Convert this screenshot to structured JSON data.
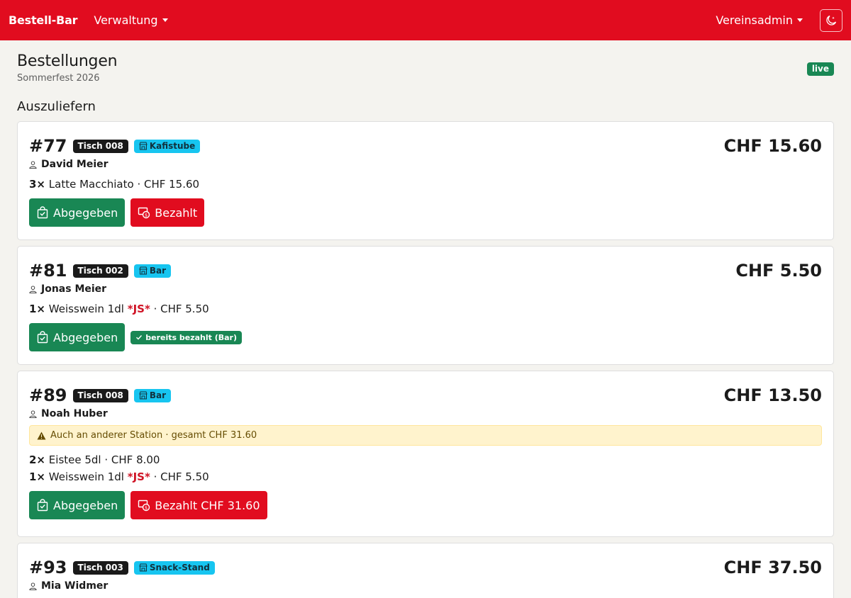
{
  "navbar": {
    "brand": "Bestell-Bar",
    "menu_label": "Verwaltung",
    "user_label": "Vereinsadmin",
    "theme_icon": "moon-stars-icon"
  },
  "page": {
    "title": "Bestellungen",
    "subtitle": "Sommerfest 2026",
    "live_badge": "live",
    "section_title": "Auszuliefern"
  },
  "colors": {
    "brand_red": "#e10c1f",
    "success_green": "#198754",
    "info_cyan": "#17c5f0",
    "warning_bg": "#fff3cd"
  },
  "orders": [
    {
      "number": "#77",
      "table": "Tisch 008",
      "station": "Kafistube",
      "customer": "David Meier",
      "total": "CHF 15.60",
      "items": [
        {
          "qty": "3×",
          "name": "Latte Macchiato",
          "tag": "",
          "price": " · CHF 15.60"
        }
      ],
      "deliver_label": "Abgegeben",
      "pay_label": "Bezahlt"
    },
    {
      "number": "#81",
      "table": "Tisch 002",
      "station": "Bar",
      "customer": "Jonas Meier",
      "total": "CHF 5.50",
      "items": [
        {
          "qty": "1×",
          "name": "Weisswein 1dl",
          "tag": "*JS*",
          "price": " · CHF 5.50"
        }
      ],
      "deliver_label": "Abgegeben",
      "paid_badge": "bereits bezahlt (Bar)"
    },
    {
      "number": "#89",
      "table": "Tisch 008",
      "station": "Bar",
      "customer": "Noah Huber",
      "total": "CHF 13.50",
      "warning": "Auch an anderer Station · gesamt CHF 31.60",
      "items": [
        {
          "qty": "2×",
          "name": "Eistee 5dl",
          "tag": "",
          "price": " · CHF 8.00"
        },
        {
          "qty": "1×",
          "name": "Weisswein 1dl",
          "tag": "*JS*",
          "price": " · CHF 5.50"
        }
      ],
      "deliver_label": "Abgegeben",
      "pay_label": "Bezahlt CHF 31.60"
    },
    {
      "number": "#93",
      "table": "Tisch 003",
      "station": "Snack-Stand",
      "customer": "Mia Widmer",
      "total": "CHF 37.50"
    }
  ]
}
